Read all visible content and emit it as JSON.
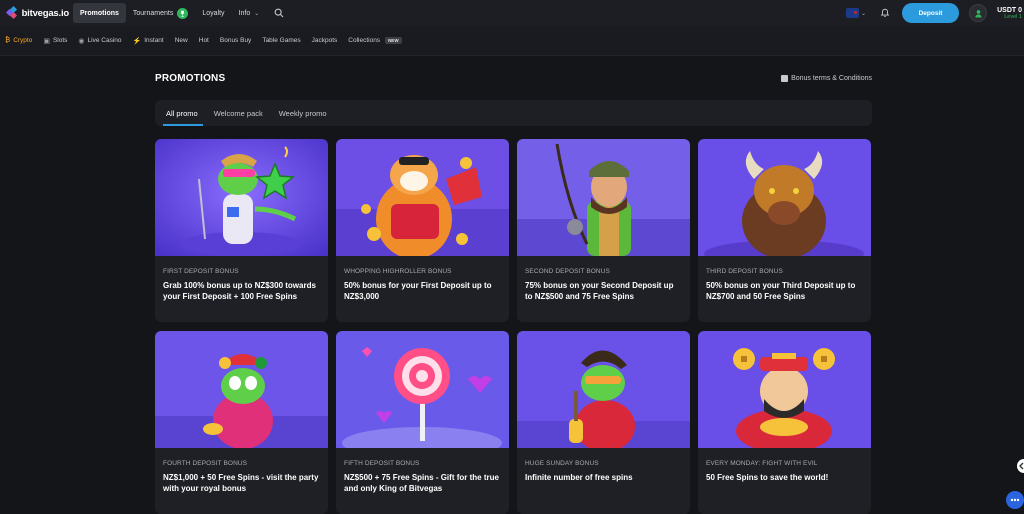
{
  "brand": {
    "name": "bitvegas.io"
  },
  "topnav": [
    {
      "label": "Promotions",
      "active": true
    },
    {
      "label": "Tournaments",
      "badge": ""
    },
    {
      "label": "Loyalty"
    },
    {
      "label": "Info"
    }
  ],
  "account": {
    "deposit_label": "Deposit",
    "balance": "USDT 0",
    "level": "Level 1"
  },
  "categories": [
    "Crypto",
    "Slots",
    "Live Casino",
    "Instant",
    "New",
    "Hot",
    "Bonus Buy",
    "Table Games",
    "Jackpots",
    "Collections"
  ],
  "collections_badge": "NEW",
  "page": {
    "title": "PROMOTIONS",
    "terms": "Bonus terms & Conditions"
  },
  "tabs": [
    "All promo",
    "Welcome pack",
    "Weekly promo"
  ],
  "promos": [
    {
      "label": "FIRST DEPOSIT BONUS",
      "desc": "Grab 100% bonus up to NZ$300 towards your First Deposit + 100 Free Spins"
    },
    {
      "label": "WHOPPING HIGHROLLER BONUS",
      "desc": "50% bonus for your First Deposit up to NZ$3,000"
    },
    {
      "label": "SECOND DEPOSIT BONUS",
      "desc": "75% bonus on your Second Deposit up to NZ$500 and 75 Free Spins"
    },
    {
      "label": "THIRD DEPOSIT BONUS",
      "desc": "50% bonus on your Third Deposit up to NZ$700 and 50 Free Spins"
    },
    {
      "label": "FOURTH DEPOSIT BONUS",
      "desc": "NZ$1,000 + 50 Free Spins - visit the party with your royal bonus"
    },
    {
      "label": "FIFTH DEPOSIT BONUS",
      "desc": "NZ$500 + 75 Free Spins - Gift for the true and only King of Bitvegas"
    },
    {
      "label": "HUGE SUNDAY BONUS",
      "desc": "Infinite number of free spins"
    },
    {
      "label": "EVERY MONDAY: FIGHT WITH EVIL",
      "desc": "50 Free Spins to save the world!"
    }
  ],
  "colors": {
    "accent": "#2c9bdd",
    "crypto": "#f7a824",
    "live": "#2fb85a",
    "card": "#1f2026",
    "promo_bg": "#6a4ee8"
  },
  "icons": [
    "search-icon",
    "bell-icon",
    "user-icon",
    "chevron-down-icon",
    "bitcoin-icon",
    "slot-icon",
    "live-icon",
    "bolt-icon",
    "document-icon",
    "chat-icon"
  ]
}
